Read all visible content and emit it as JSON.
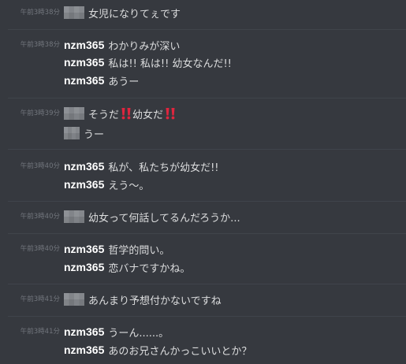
{
  "messages": [
    {
      "time": "午前3時38分",
      "author": "",
      "text": "女児になりてぇです"
    },
    {
      "time": "午前3時38分",
      "author": "nzm365",
      "text": "わかりみが深い"
    },
    {
      "author": "nzm365",
      "text": "私は!! 私は!! 幼女なんだ!!"
    },
    {
      "author": "nzm365",
      "text": "あうー"
    },
    {
      "time": "午前3時39分",
      "author": "",
      "text_a": "そうだ",
      "text_b": "幼女だ",
      "icon": "double-exclamation-icon"
    },
    {
      "author": "",
      "text": "うー"
    },
    {
      "time": "午前3時40分",
      "author": "nzm365",
      "text": "私が、私たちが幼女だ!!"
    },
    {
      "author": "nzm365",
      "text": "えう〜。"
    },
    {
      "time": "午前3時40分",
      "author": "",
      "text": "幼女って何話してるんだろうか..."
    },
    {
      "time": "午前3時40分",
      "author": "nzm365",
      "text": "哲学的問い。"
    },
    {
      "author": "nzm365",
      "text": "恋バナですかね。"
    },
    {
      "time": "午前3時41分",
      "author": "",
      "text": "あんまり予想付かないですね"
    },
    {
      "time": "午前3時41分",
      "author": "nzm365",
      "text": "うーん......。"
    },
    {
      "author": "nzm365",
      "text": "あのお兄さんかっこいいとか？"
    }
  ],
  "colors": {
    "background": "#36393f",
    "timestamp": "#72767d",
    "author": "#ffffff",
    "text": "#dcddde",
    "divider": "#40444b",
    "exclamation": "#e0253e"
  }
}
